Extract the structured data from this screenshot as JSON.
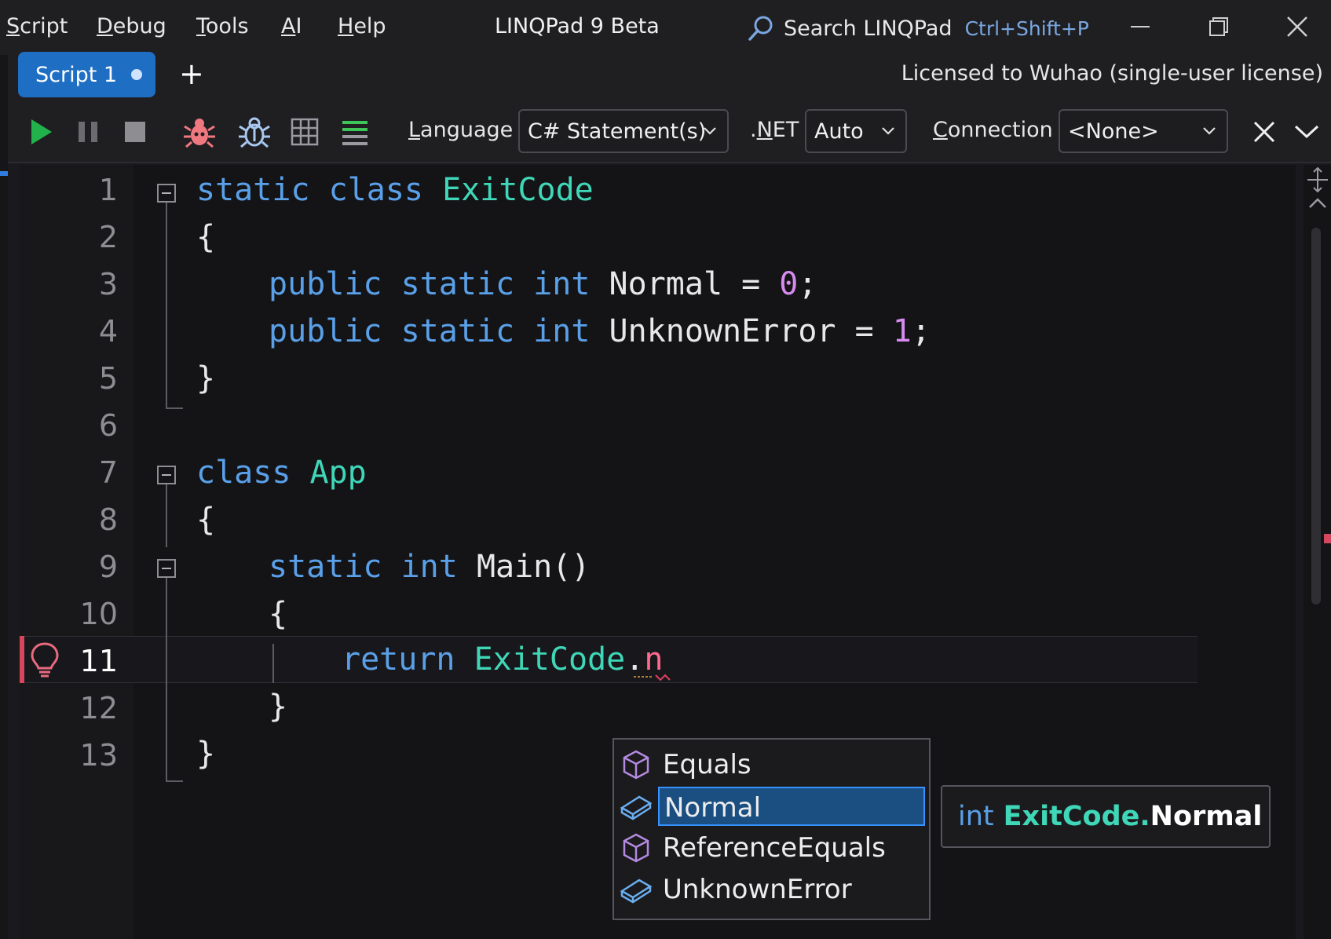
{
  "menu": {
    "items": [
      {
        "accel": "S",
        "rest": "cript"
      },
      {
        "accel": "D",
        "rest": "ebug"
      },
      {
        "accel": "T",
        "rest": "ools"
      },
      {
        "accel": "A",
        "rest": "I"
      },
      {
        "accel": "H",
        "rest": "elp"
      }
    ],
    "title": "LINQPad 9 Beta",
    "search_label": "Search LINQPad",
    "search_shortcut": "Ctrl+Shift+P"
  },
  "tabs": {
    "active": "Script 1",
    "new_tab": "+",
    "license": "Licensed to Wuhao (single-user license)"
  },
  "toolbar": {
    "language_accel": "L",
    "language_rest": "anguage",
    "language_value": "C# Statement(s)",
    "dotnet_prefix": ".",
    "dotnet_accel": "N",
    "dotnet_rest": "ET",
    "dotnet_value": "Auto",
    "connection_accel": "C",
    "connection_rest": "onnection",
    "connection_value": "<None>"
  },
  "editor": {
    "line_numbers": [
      "1",
      "2",
      "3",
      "4",
      "5",
      "6",
      "7",
      "8",
      "9",
      "10",
      "11",
      "12",
      "13"
    ],
    "current_line": "11",
    "code": {
      "l1_kw1": "static",
      "l1_kw2": "class",
      "l1_type": "ExitCode",
      "l2": "{",
      "l3_kw1": "public",
      "l3_kw2": "static",
      "l3_kw3": "int",
      "l3_id": "Normal",
      "l3_eq": " = ",
      "l3_num": "0",
      "l3_end": ";",
      "l4_kw1": "public",
      "l4_kw2": "static",
      "l4_kw3": "int",
      "l4_id": "UnknownError",
      "l4_eq": " = ",
      "l4_num": "1",
      "l4_end": ";",
      "l5": "}",
      "l7_kw": "class",
      "l7_type": "App",
      "l8": "{",
      "l9_kw1": "static",
      "l9_kw2": "int",
      "l9_id": "Main()",
      "l10": "{",
      "l11_kw": "return",
      "l11_type": "ExitCode",
      "l11_dot": ".",
      "l11_typed": "n",
      "l12": "}",
      "l13": "}"
    }
  },
  "completion": {
    "items": [
      "Equals",
      "Normal",
      "ReferenceEquals",
      "UnknownError"
    ],
    "selected": "Normal",
    "tooltip_kw": "int",
    "tooltip_type": "ExitCode.",
    "tooltip_member": "Normal"
  },
  "colors": {
    "keyword": "#5aa0e8",
    "type": "#3fd7b8",
    "number": "#d78bf0",
    "accent": "#1e6fc4",
    "error": "#d7465f"
  }
}
